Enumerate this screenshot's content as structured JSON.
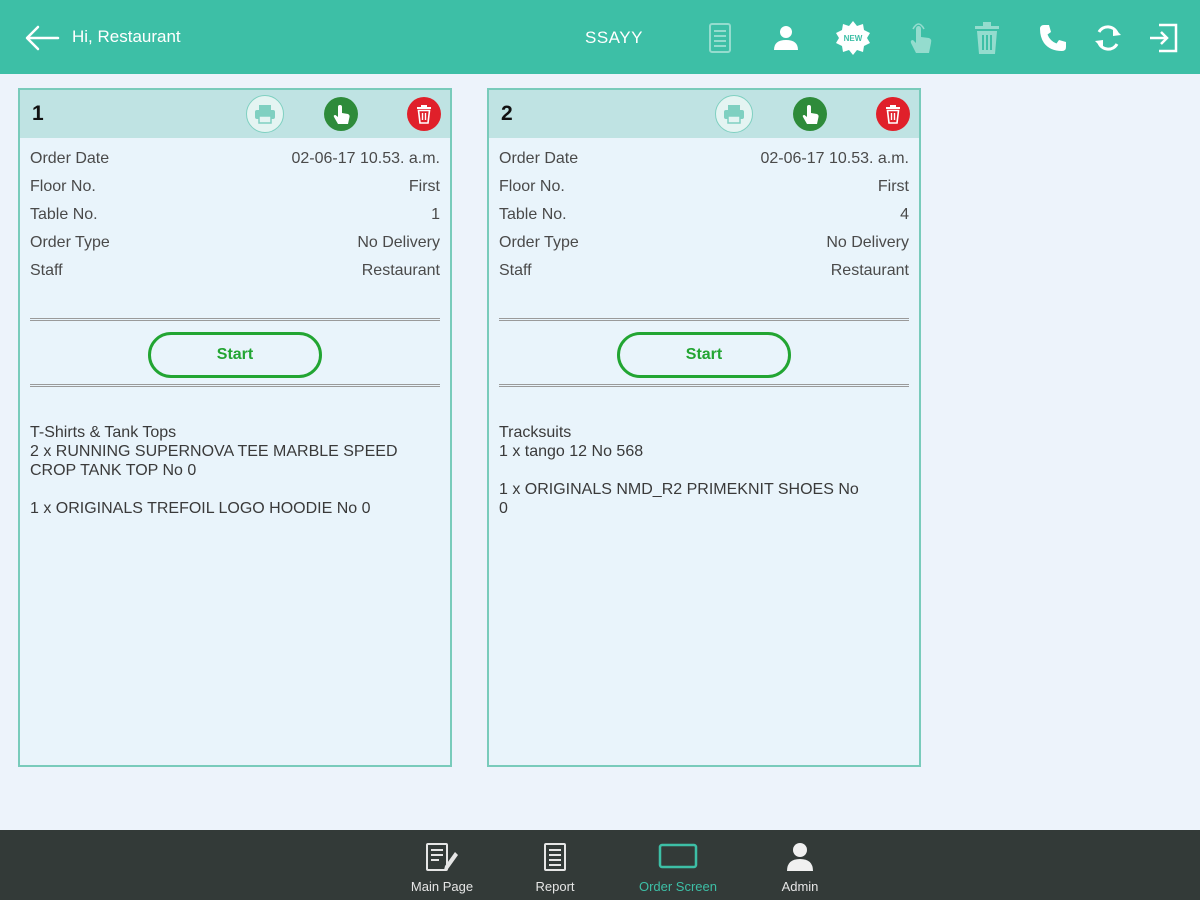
{
  "header": {
    "greeting": "Hi,  Restaurant",
    "title": "SSAYY",
    "icons": [
      "back-arrow-icon",
      "report-icon",
      "user-icon",
      "new-badge-icon",
      "touch-hand-icon",
      "trash-icon",
      "phone-icon",
      "refresh-icon",
      "logout-icon"
    ]
  },
  "orders": [
    {
      "number": "1",
      "rows": [
        {
          "label": "Order Date",
          "value": "02-06-17 10.53. a.m."
        },
        {
          "label": "Floor No.",
          "value": "First"
        },
        {
          "label": "Table No.",
          "value": "1"
        },
        {
          "label": "Order Type",
          "value": "No Delivery"
        },
        {
          "label": "Staff",
          "value": "Restaurant"
        }
      ],
      "start_label": "Start",
      "items": {
        "category": "T-Shirts & Tank Tops",
        "line1a": "2 x RUNNING SUPERNOVA TEE MARBLE SPEED",
        "line1b": "CROP TANK TOP No 0",
        "line2a": "1 x ORIGINALS TREFOIL LOGO HOODIE No 0"
      }
    },
    {
      "number": "2",
      "rows": [
        {
          "label": "Order Date",
          "value": "02-06-17 10.53. a.m."
        },
        {
          "label": "Floor No.",
          "value": "First"
        },
        {
          "label": "Table No.",
          "value": "4"
        },
        {
          "label": "Order Type",
          "value": "No Delivery"
        },
        {
          "label": "Staff",
          "value": "Restaurant"
        }
      ],
      "start_label": "Start",
      "items": {
        "category": "Tracksuits",
        "line1a": "1 x tango 12 No 568",
        "line2a": "1 x ORIGINALS NMD_R2 PRIMEKNIT SHOES No",
        "line2b": "0"
      }
    }
  ],
  "nav": [
    {
      "label": "Main Page",
      "icon": "main-page-icon",
      "active": false
    },
    {
      "label": "Report",
      "icon": "report-icon",
      "active": false
    },
    {
      "label": "Order Screen",
      "icon": "order-screen-icon",
      "active": true
    },
    {
      "label": "Admin",
      "icon": "admin-icon",
      "active": false
    }
  ],
  "colors": {
    "accent": "#3dbfa6",
    "background": "#edf3fb",
    "card_header": "#bfe3e3",
    "start_green": "#22a532",
    "delete_red": "#e0202a",
    "nav_bg": "#333a38"
  }
}
